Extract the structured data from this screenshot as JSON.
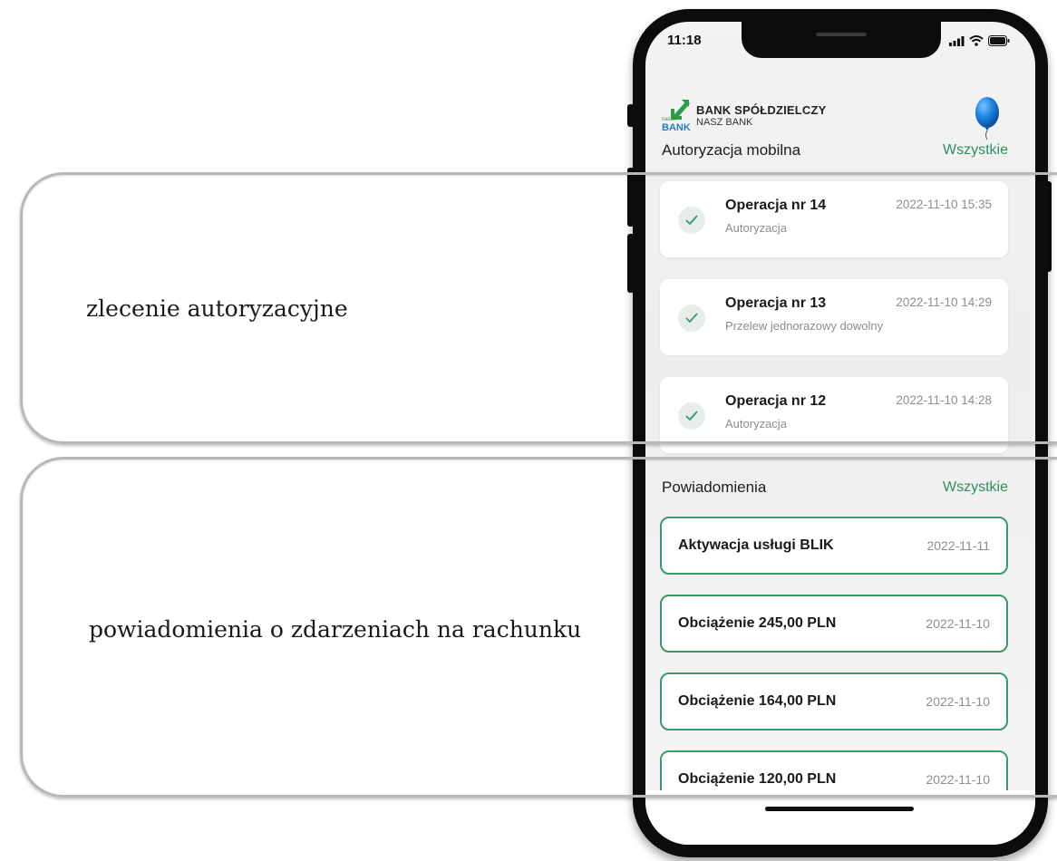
{
  "annotations": {
    "authorization_label": "zlecenie autoryzacyjne",
    "notifications_label": "powiadomienia o zdarzeniach na rachunku"
  },
  "status_bar": {
    "time": "11:18"
  },
  "bank": {
    "name": "BANK SPÓŁDZIELCZY",
    "sub": "NASZ BANK",
    "logo_text_small": "nasz",
    "logo_text": "BANK"
  },
  "mobile_auth": {
    "title": "Autoryzacja mobilna",
    "link": "Wszystkie",
    "items": [
      {
        "title": "Operacja nr 14",
        "subtitle": "Autoryzacja",
        "date": "2022-11-10 15:35"
      },
      {
        "title": "Operacja nr 13",
        "subtitle": "Przelew jednorazowy dowolny",
        "date": "2022-11-10 14:29"
      },
      {
        "title": "Operacja nr 12",
        "subtitle": "Autoryzacja",
        "date": "2022-11-10 14:28"
      }
    ]
  },
  "notifications": {
    "title": "Powiadomienia",
    "link": "Wszystkie",
    "items": [
      {
        "title": "Aktywacja usługi BLIK",
        "date": "2022-11-11"
      },
      {
        "title": "Obciążenie 245,00 PLN",
        "date": "2022-11-10"
      },
      {
        "title": "Obciążenie 164,00 PLN",
        "date": "2022-11-10"
      },
      {
        "title": "Obciążenie 120,00 PLN",
        "date": "2022-11-10"
      }
    ]
  },
  "colors": {
    "accent": "#2f8f5b",
    "border": "#3a9b68",
    "avatar": "#1e88e5"
  },
  "icons": [
    "signal-icon",
    "wifi-icon",
    "battery-icon",
    "check-icon",
    "balloon-avatar-icon",
    "bank-logo-icon"
  ]
}
